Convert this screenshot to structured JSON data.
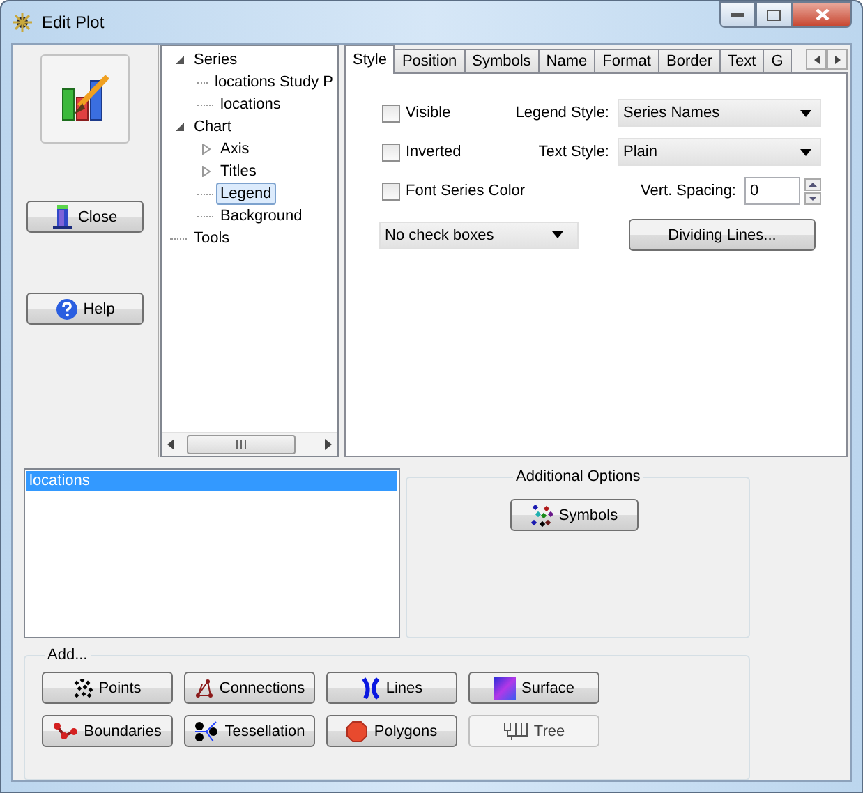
{
  "window": {
    "title": "Edit Plot"
  },
  "side_buttons": [
    {
      "label": "Close",
      "kind": "close"
    },
    {
      "label": "Help",
      "kind": "help"
    }
  ],
  "tree": [
    {
      "label": "Series",
      "expanded": true,
      "selected": false,
      "children": [
        {
          "label": "locations Study P",
          "selected": false
        },
        {
          "label": "locations",
          "selected": false
        }
      ]
    },
    {
      "label": "Chart",
      "expanded": true,
      "selected": false,
      "children": [
        {
          "label": "Axis",
          "expanded": false,
          "selected": false
        },
        {
          "label": "Titles",
          "expanded": false,
          "selected": false
        },
        {
          "label": "Legend",
          "selected": true
        },
        {
          "label": "Background",
          "selected": false
        }
      ]
    },
    {
      "label": "Tools",
      "selected": false
    }
  ],
  "tabs": [
    {
      "label": "Style",
      "selected": true
    },
    {
      "label": "Position",
      "selected": false
    },
    {
      "label": "Symbols",
      "selected": false
    },
    {
      "label": "Name",
      "selected": false
    },
    {
      "label": "Format",
      "selected": false
    },
    {
      "label": "Border",
      "selected": false
    },
    {
      "label": "Text",
      "selected": false
    },
    {
      "label": "G",
      "selected": false
    }
  ],
  "checkboxes": [
    {
      "label": "Visible",
      "checked": false
    },
    {
      "label": "Inverted",
      "checked": false
    },
    {
      "label": "Font Series Color",
      "checked": false
    }
  ],
  "checkbox_mode": {
    "value": "No check boxes"
  },
  "legend_style": {
    "label": "Legend Style:",
    "value": "Series Names"
  },
  "text_style": {
    "label": "Text Style:",
    "value": "Plain"
  },
  "vert_spacing": {
    "label": "Vert. Spacing:",
    "value": "0"
  },
  "dividing_lines_button": "Dividing Lines...",
  "series_list": [
    {
      "label": "locations",
      "selected": true
    }
  ],
  "additional_options": {
    "title": "Additional Options",
    "button": "Symbols"
  },
  "add": {
    "title": "Add...",
    "buttons": [
      {
        "label": "Points",
        "kind": "points",
        "disabled": false
      },
      {
        "label": "Connections",
        "kind": "connections",
        "disabled": false
      },
      {
        "label": "Lines",
        "kind": "lines",
        "disabled": false
      },
      {
        "label": "Surface",
        "kind": "surface",
        "disabled": false
      },
      {
        "label": "Boundaries",
        "kind": "boundaries",
        "disabled": false
      },
      {
        "label": "Tessellation",
        "kind": "tessellation",
        "disabled": false
      },
      {
        "label": "Polygons",
        "kind": "polygons",
        "disabled": false
      },
      {
        "label": "Tree",
        "kind": "tree",
        "disabled": true
      }
    ]
  }
}
